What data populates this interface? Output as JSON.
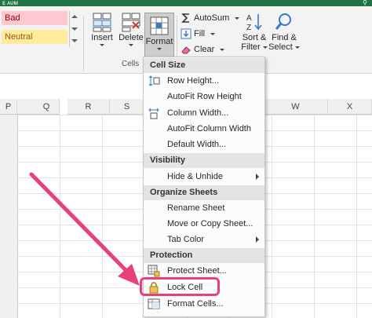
{
  "titlebar": {
    "left_text": "ᴇ ᴀᴜᴍ",
    "right_icon": "share-person-icon"
  },
  "ribbon": {
    "styles": {
      "bad": "Bad",
      "neutral": "Neutral"
    },
    "cells_group": {
      "label": "Cells",
      "insert": "Insert",
      "delete": "Delete",
      "format": "Format"
    },
    "editing": {
      "autosum": "AutoSum",
      "fill": "Fill",
      "clear": "Clear",
      "sort_filter_line1": "Sort &",
      "sort_filter_line2": "Filter",
      "find_select_line1": "Find &",
      "find_select_line2": "Select"
    }
  },
  "columns": [
    {
      "label": "P"
    },
    {
      "label": "Q"
    },
    {
      "label": "R"
    },
    {
      "label": "S"
    },
    {
      "label": "W"
    },
    {
      "label": "X"
    }
  ],
  "menu": {
    "cell_size": "Cell Size",
    "row_height": "Row Height...",
    "autofit_row": "AutoFit Row Height",
    "column_width": "Column Width...",
    "autofit_column": "AutoFit Column Width",
    "default_width": "Default Width...",
    "visibility": "Visibility",
    "hide_unhide": "Hide & Unhide",
    "organize": "Organize Sheets",
    "rename": "Rename Sheet",
    "move_copy": "Move or Copy Sheet...",
    "tab_color": "Tab Color",
    "protection": "Protection",
    "protect_sheet": "Protect Sheet...",
    "lock_cell": "Lock Cell",
    "format_cells": "Format Cells..."
  },
  "colors": {
    "accent": "#217346",
    "highlight": "#e8407a",
    "bad_fill": "#ffc7ce",
    "neutral_fill": "#ffeb9c"
  }
}
